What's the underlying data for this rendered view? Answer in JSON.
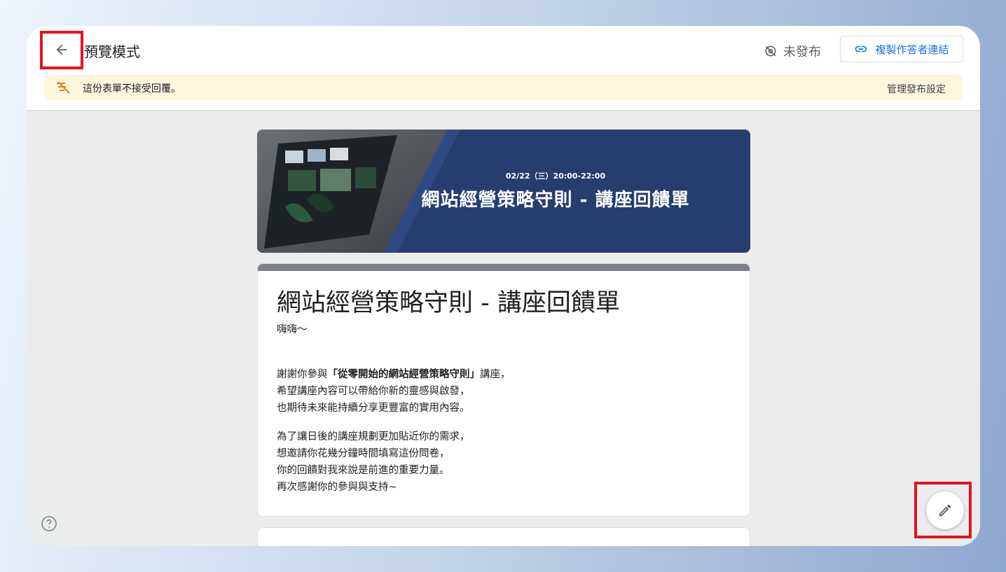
{
  "header": {
    "title": "預覽模式",
    "status_label": "未發布",
    "copy_link_label": "複製作答者連結"
  },
  "notice": {
    "message": "這份表單不接受回覆。",
    "manage_label": "管理發布設定"
  },
  "banner": {
    "date": "02/22（三）20:00-22:00",
    "title": "網站經營策略守則 - 講座回饋單"
  },
  "form": {
    "title": "網站經營策略守則 - 講座回饋單",
    "greeting": "嗨嗨～",
    "para1_line1_prefix": "謝謝你參與",
    "para1_line1_bold": "「從零開始的網站經營策略守則」",
    "para1_line1_suffix": "講座，",
    "para1_line2": "希望講座內容可以帶給你新的靈感與啟發，",
    "para1_line3": "也期待未來能持續分享更豐富的實用內容。",
    "para2_line1": "為了讓日後的講座規劃更加貼近你的需求，",
    "para2_line2": "想邀請你花幾分鐘時間填寫這份問卷，",
    "para2_line3": "你的回饋對我來說是前進的重要力量。",
    "para2_line4": "再次感謝你的參與與支持~"
  },
  "icons": {
    "back": "arrow-back-icon",
    "status": "visibility-off-icon",
    "link": "link-icon",
    "notice": "no-responses-icon",
    "help": "help-icon",
    "edit": "pencil-icon"
  },
  "colors": {
    "accent": "#1a73e8",
    "banner": "#263e6e",
    "notice_bg": "#fdf6dc",
    "highlight": "#e2141f"
  }
}
